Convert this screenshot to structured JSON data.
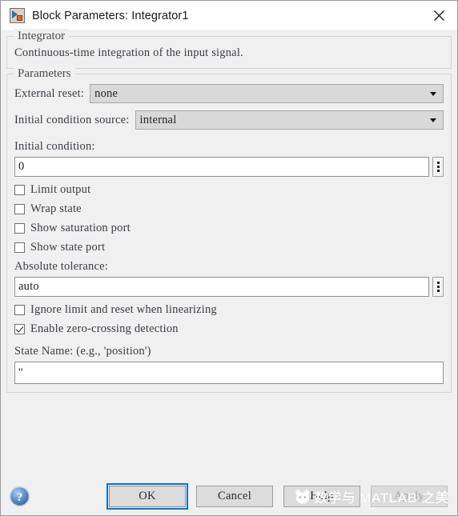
{
  "window": {
    "title": "Block Parameters: Integrator1",
    "icon": "simulink-block-icon",
    "close_label": "×"
  },
  "description_group": {
    "legend": "Integrator",
    "text": "Continuous-time integration of the input signal."
  },
  "parameters_group": {
    "legend": "Parameters",
    "external_reset": {
      "label": "External reset:",
      "value": "none"
    },
    "initial_condition_source": {
      "label": "Initial condition source:",
      "value": "internal"
    },
    "initial_condition": {
      "label": "Initial condition:",
      "value": "0"
    },
    "checkboxes_upper": [
      {
        "label": "Limit output",
        "checked": false
      },
      {
        "label": "Wrap state",
        "checked": false
      },
      {
        "label": "Show saturation port",
        "checked": false
      },
      {
        "label": "Show state port",
        "checked": false
      }
    ],
    "absolute_tolerance": {
      "label": "Absolute tolerance:",
      "value": "auto"
    },
    "checkboxes_lower": [
      {
        "label": "Ignore limit and reset when linearizing",
        "checked": false
      },
      {
        "label": "Enable zero-crossing detection",
        "checked": true
      }
    ],
    "state_name": {
      "label": "State Name: (e.g., 'position')",
      "value": "''"
    }
  },
  "footer": {
    "help_icon": "help-circle-icon",
    "buttons": {
      "ok": "OK",
      "cancel": "Cancel",
      "help": "Help",
      "apply": "Apply"
    }
  },
  "watermark": {
    "text": "数学与 MATLAB 之美",
    "logo": "cat-face-logo"
  },
  "colors": {
    "dialog_bg": "#f0f0f0",
    "titlebar_bg": "#ffffff",
    "focus_blue": "#0d73c8",
    "combo_bg": "#d9d9d9",
    "input_bg": "#ffffff",
    "text": "#3b3b46"
  }
}
